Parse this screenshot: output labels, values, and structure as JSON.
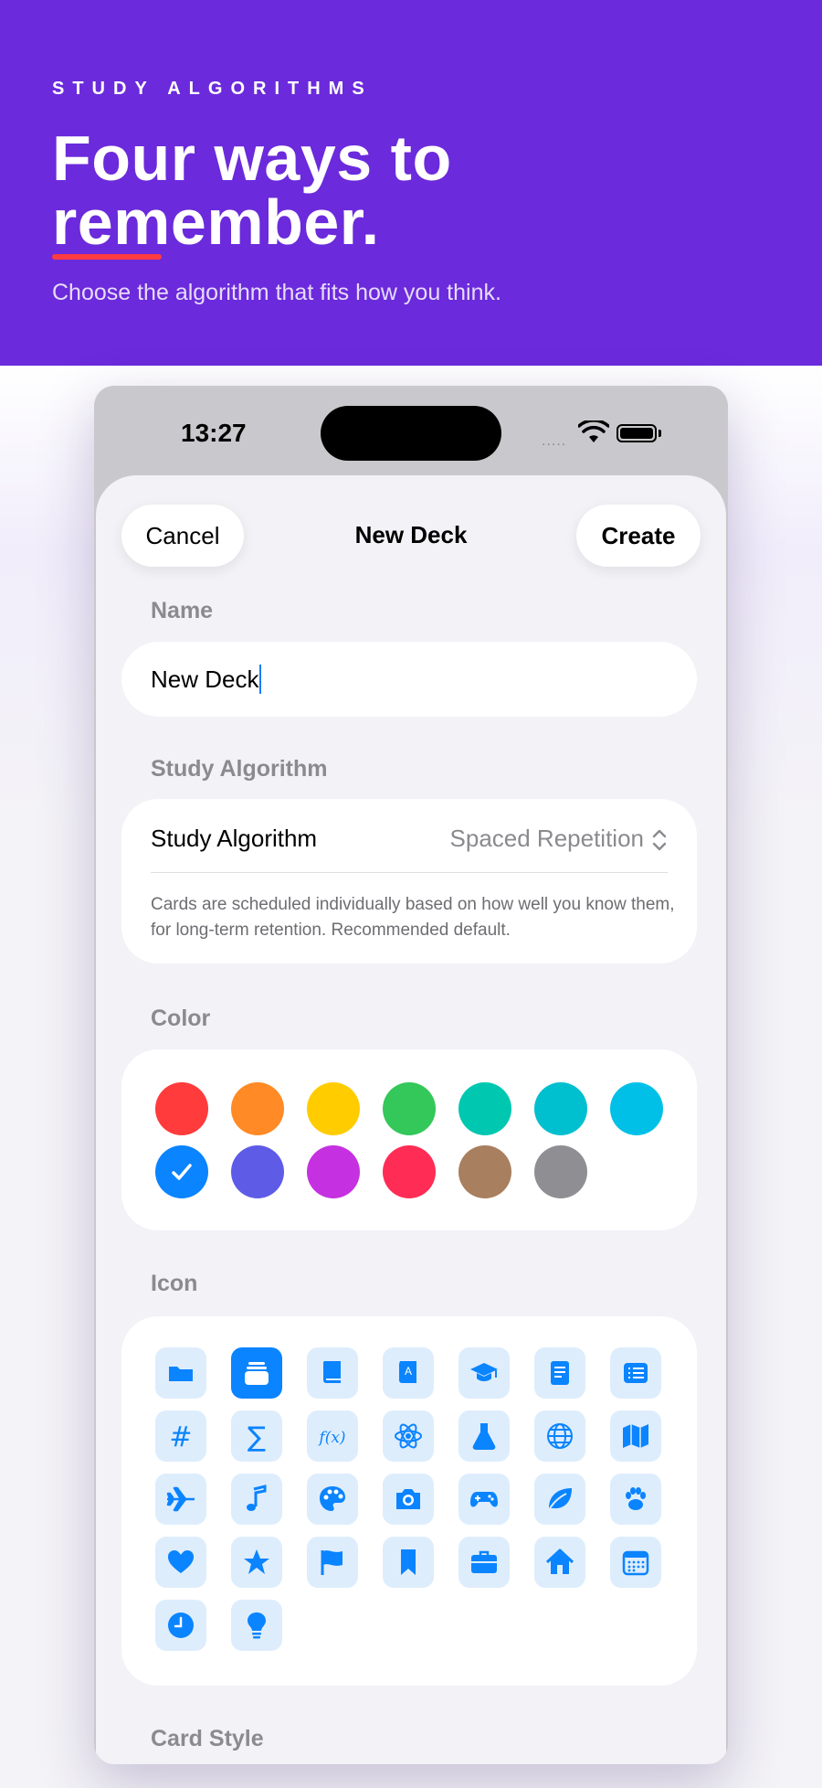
{
  "hero": {
    "eyebrow": "STUDY ALGORITHMS",
    "headline_line1": "Four ways to",
    "headline_line2": "remember.",
    "subtitle": "Choose the algorithm that fits how you think.",
    "background": "#6b2adb",
    "underline_color": "#ff3b42"
  },
  "status_bar": {
    "time": "13:27",
    "signal": "....."
  },
  "sheet": {
    "title": "New Deck",
    "cancel_label": "Cancel",
    "create_label": "Create"
  },
  "name_section": {
    "label": "Name",
    "value": "New Deck"
  },
  "algorithm_section": {
    "label": "Study Algorithm",
    "row_label": "Study Algorithm",
    "selected": "Spaced Repetition",
    "description": "Cards are scheduled individually based on how well you know them, for long-term retention. Recommended default."
  },
  "color_section": {
    "label": "Color",
    "selected_index": 7,
    "swatches": [
      {
        "name": "red",
        "hex": "#ff3b3b"
      },
      {
        "name": "orange",
        "hex": "#ff8a26"
      },
      {
        "name": "yellow",
        "hex": "#ffcc00"
      },
      {
        "name": "green",
        "hex": "#34c759"
      },
      {
        "name": "mint",
        "hex": "#00c7b0"
      },
      {
        "name": "teal",
        "hex": "#00bfcf"
      },
      {
        "name": "cyan",
        "hex": "#00c0e8"
      },
      {
        "name": "blue",
        "hex": "#0a84ff"
      },
      {
        "name": "indigo",
        "hex": "#5e5ce6"
      },
      {
        "name": "purple",
        "hex": "#c531e0"
      },
      {
        "name": "pink",
        "hex": "#ff2d55"
      },
      {
        "name": "brown",
        "hex": "#a87f5f"
      },
      {
        "name": "gray",
        "hex": "#8e8e93"
      }
    ]
  },
  "icon_section": {
    "label": "Icon",
    "selected_index": 1,
    "icons": [
      "folder-icon",
      "stack-icon",
      "book-icon",
      "dictionary-icon",
      "graduation-cap-icon",
      "notebook-icon",
      "list-icon",
      "hashtag-icon",
      "sigma-icon",
      "function-icon",
      "atom-icon",
      "flask-icon",
      "globe-icon",
      "map-icon",
      "airplane-icon",
      "music-note-icon",
      "palette-icon",
      "camera-icon",
      "gamepad-icon",
      "leaf-icon",
      "pawprint-icon",
      "heart-icon",
      "star-icon",
      "flag-icon",
      "bookmark-icon",
      "briefcase-icon",
      "house-icon",
      "calendar-icon",
      "clock-icon",
      "lightbulb-icon"
    ],
    "glyph_text": {
      "hashtag-icon": "#",
      "sigma-icon": "∑",
      "function-icon": "f(x)"
    }
  },
  "card_style_section": {
    "label": "Card Style"
  }
}
